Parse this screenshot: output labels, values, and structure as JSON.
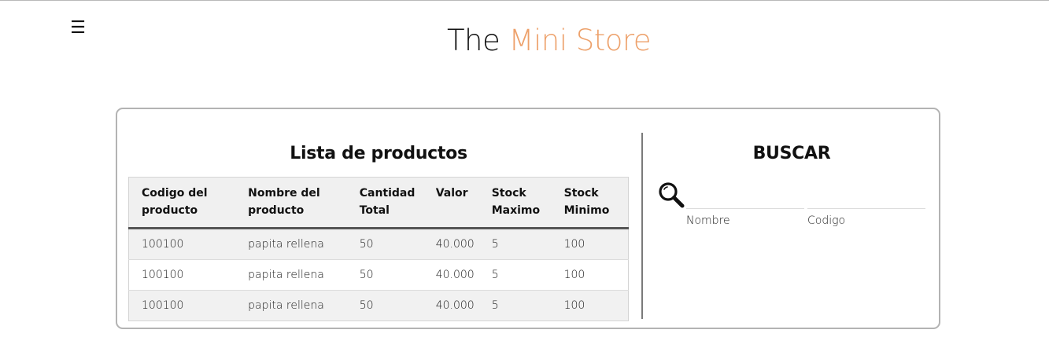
{
  "header": {
    "menu_icon": "hamburger-menu-icon",
    "menu_glyph": "☰",
    "title_main": "The",
    "title_accent": "Mini Store",
    "accent_color": "#eda16b"
  },
  "products": {
    "title": "Lista de productos",
    "columns": [
      {
        "line1": "Codigo del",
        "line2": "producto"
      },
      {
        "line1": "Nombre del",
        "line2": "producto"
      },
      {
        "line1": "Cantidad",
        "line2": "Total"
      },
      {
        "line1": "Valor",
        "line2": ""
      },
      {
        "line1": "Stock",
        "line2": "Maximo"
      },
      {
        "line1": "Stock",
        "line2": "Minimo"
      }
    ],
    "rows": [
      [
        "100100",
        "papita rellena",
        "50",
        "40.000",
        "5",
        "100"
      ],
      [
        "100100",
        "papita rellena",
        "50",
        "40.000",
        "5",
        "100"
      ],
      [
        "100100",
        "papita rellena",
        "50",
        "40.000",
        "5",
        "100"
      ]
    ]
  },
  "search": {
    "title": "BUSCAR",
    "icon": "magnifier-icon",
    "fields": [
      {
        "label": "Nombre",
        "value": ""
      },
      {
        "label": "Codigo",
        "value": ""
      }
    ]
  }
}
